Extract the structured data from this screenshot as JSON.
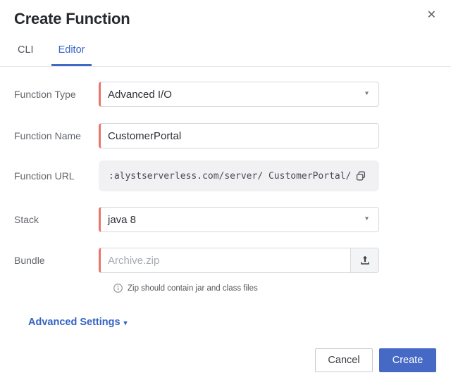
{
  "dialog": {
    "title": "Create Function"
  },
  "icons": {
    "close": "✕",
    "caret_down": "▾",
    "advanced_caret": "▾"
  },
  "tabs": {
    "cli": "CLI",
    "editor": "Editor",
    "active_tab": "Editor"
  },
  "form": {
    "function_type": {
      "label": "Function Type",
      "value": "Advanced I/O"
    },
    "function_name": {
      "label": "Function Name",
      "value": "CustomerPortal"
    },
    "function_url": {
      "label": "Function URL",
      "value": ":alystserverless.com/server/ CustomerPortal/"
    },
    "stack": {
      "label": "Stack",
      "value": "java 8"
    },
    "bundle": {
      "label": "Bundle",
      "placeholder": "Archive.zip"
    },
    "bundle_note": "Zip should contain jar and class files"
  },
  "advanced_settings_label": "Advanced Settings",
  "actions": {
    "cancel": "Cancel",
    "create": "Create"
  },
  "colors": {
    "accent_blue": "#3a66c8",
    "create_button_blue": "#4569c4",
    "required_field_red": "#e8756c",
    "url_box_gray": "#f1f1f4"
  }
}
